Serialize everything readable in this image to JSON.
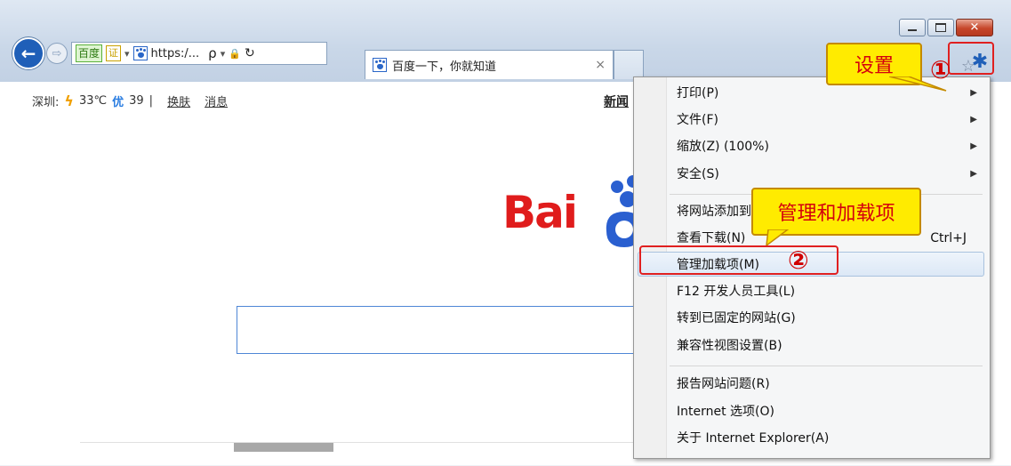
{
  "browser": {
    "address_badge": "百度",
    "cert_badge": "证",
    "address_text": "https:/...",
    "tab_title": "百度一下，你就知道",
    "tab_close": "×",
    "back_glyph": "←",
    "forward_glyph": "⇨",
    "close_glyph": "✕",
    "star_glyph": "☆",
    "gear_glyph": "✱",
    "dropdown_glyph": "▾",
    "search_glyph": "ρ",
    "lock_glyph": "🔒",
    "refresh_glyph": "↻"
  },
  "page": {
    "city": "深圳:",
    "temperature": "33℃",
    "aqi_label": "优",
    "aqi_value": "39",
    "separator": "|",
    "skin_link": "换肤",
    "message_link": "消息",
    "news_link": "新闻",
    "logo_text": "Bai"
  },
  "menu": {
    "items": [
      {
        "label": "打印(P)",
        "arrow": "▶"
      },
      {
        "label": "文件(F)",
        "arrow": "▶"
      },
      {
        "label": "缩放(Z) (100%)",
        "arrow": "▶"
      },
      {
        "label": "安全(S)",
        "arrow": "▶"
      },
      {
        "label": "将网站添加到"
      },
      {
        "label": "查看下载(N)",
        "shortcut": "Ctrl+J"
      },
      {
        "label": "管理加载项(M)"
      },
      {
        "label": "F12 开发人员工具(L)"
      },
      {
        "label": "转到已固定的网站(G)"
      },
      {
        "label": "兼容性视图设置(B)"
      },
      {
        "label": "报告网站问题(R)"
      },
      {
        "label": "Internet 选项(O)"
      },
      {
        "label": "关于 Internet Explorer(A)"
      }
    ]
  },
  "annotations": {
    "settings_callout": "设置",
    "manage_callout": "管理和加载项",
    "step1": "①",
    "step2": "②"
  },
  "colors": {
    "accent_red": "#d4000d",
    "callout_yellow": "#ffeb00",
    "ie_blue": "#1f5fb8",
    "baidu_red": "#e01c1c"
  }
}
